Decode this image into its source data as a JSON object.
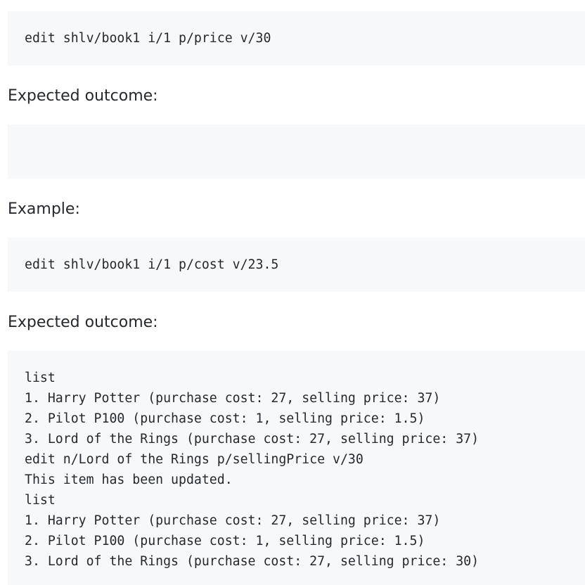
{
  "sections": {
    "command_1": "edit shlv/book1 i/1 p/price v/30",
    "expected_label_1": "Expected outcome:",
    "expected_output_1": "",
    "example_label": "Example:",
    "command_2": "edit shlv/book1 i/1 p/cost v/23.5",
    "expected_label_2": "Expected outcome:",
    "output_lines": [
      "list",
      "1. Harry Potter (purchase cost: 27, selling price: 37)",
      "2. Pilot P100 (purchase cost: 1, selling price: 1.5)",
      "3. Lord of the Rings (purchase cost: 27, selling price: 37)",
      "edit n/Lord of the Rings p/sellingPrice v/30",
      "This item has been updated.",
      "list",
      "1. Harry Potter (purchase cost: 27, selling price: 37)",
      "2. Pilot P100 (purchase cost: 1, selling price: 1.5)",
      "3. Lord of the Rings (purchase cost: 27, selling price: 30)"
    ]
  }
}
